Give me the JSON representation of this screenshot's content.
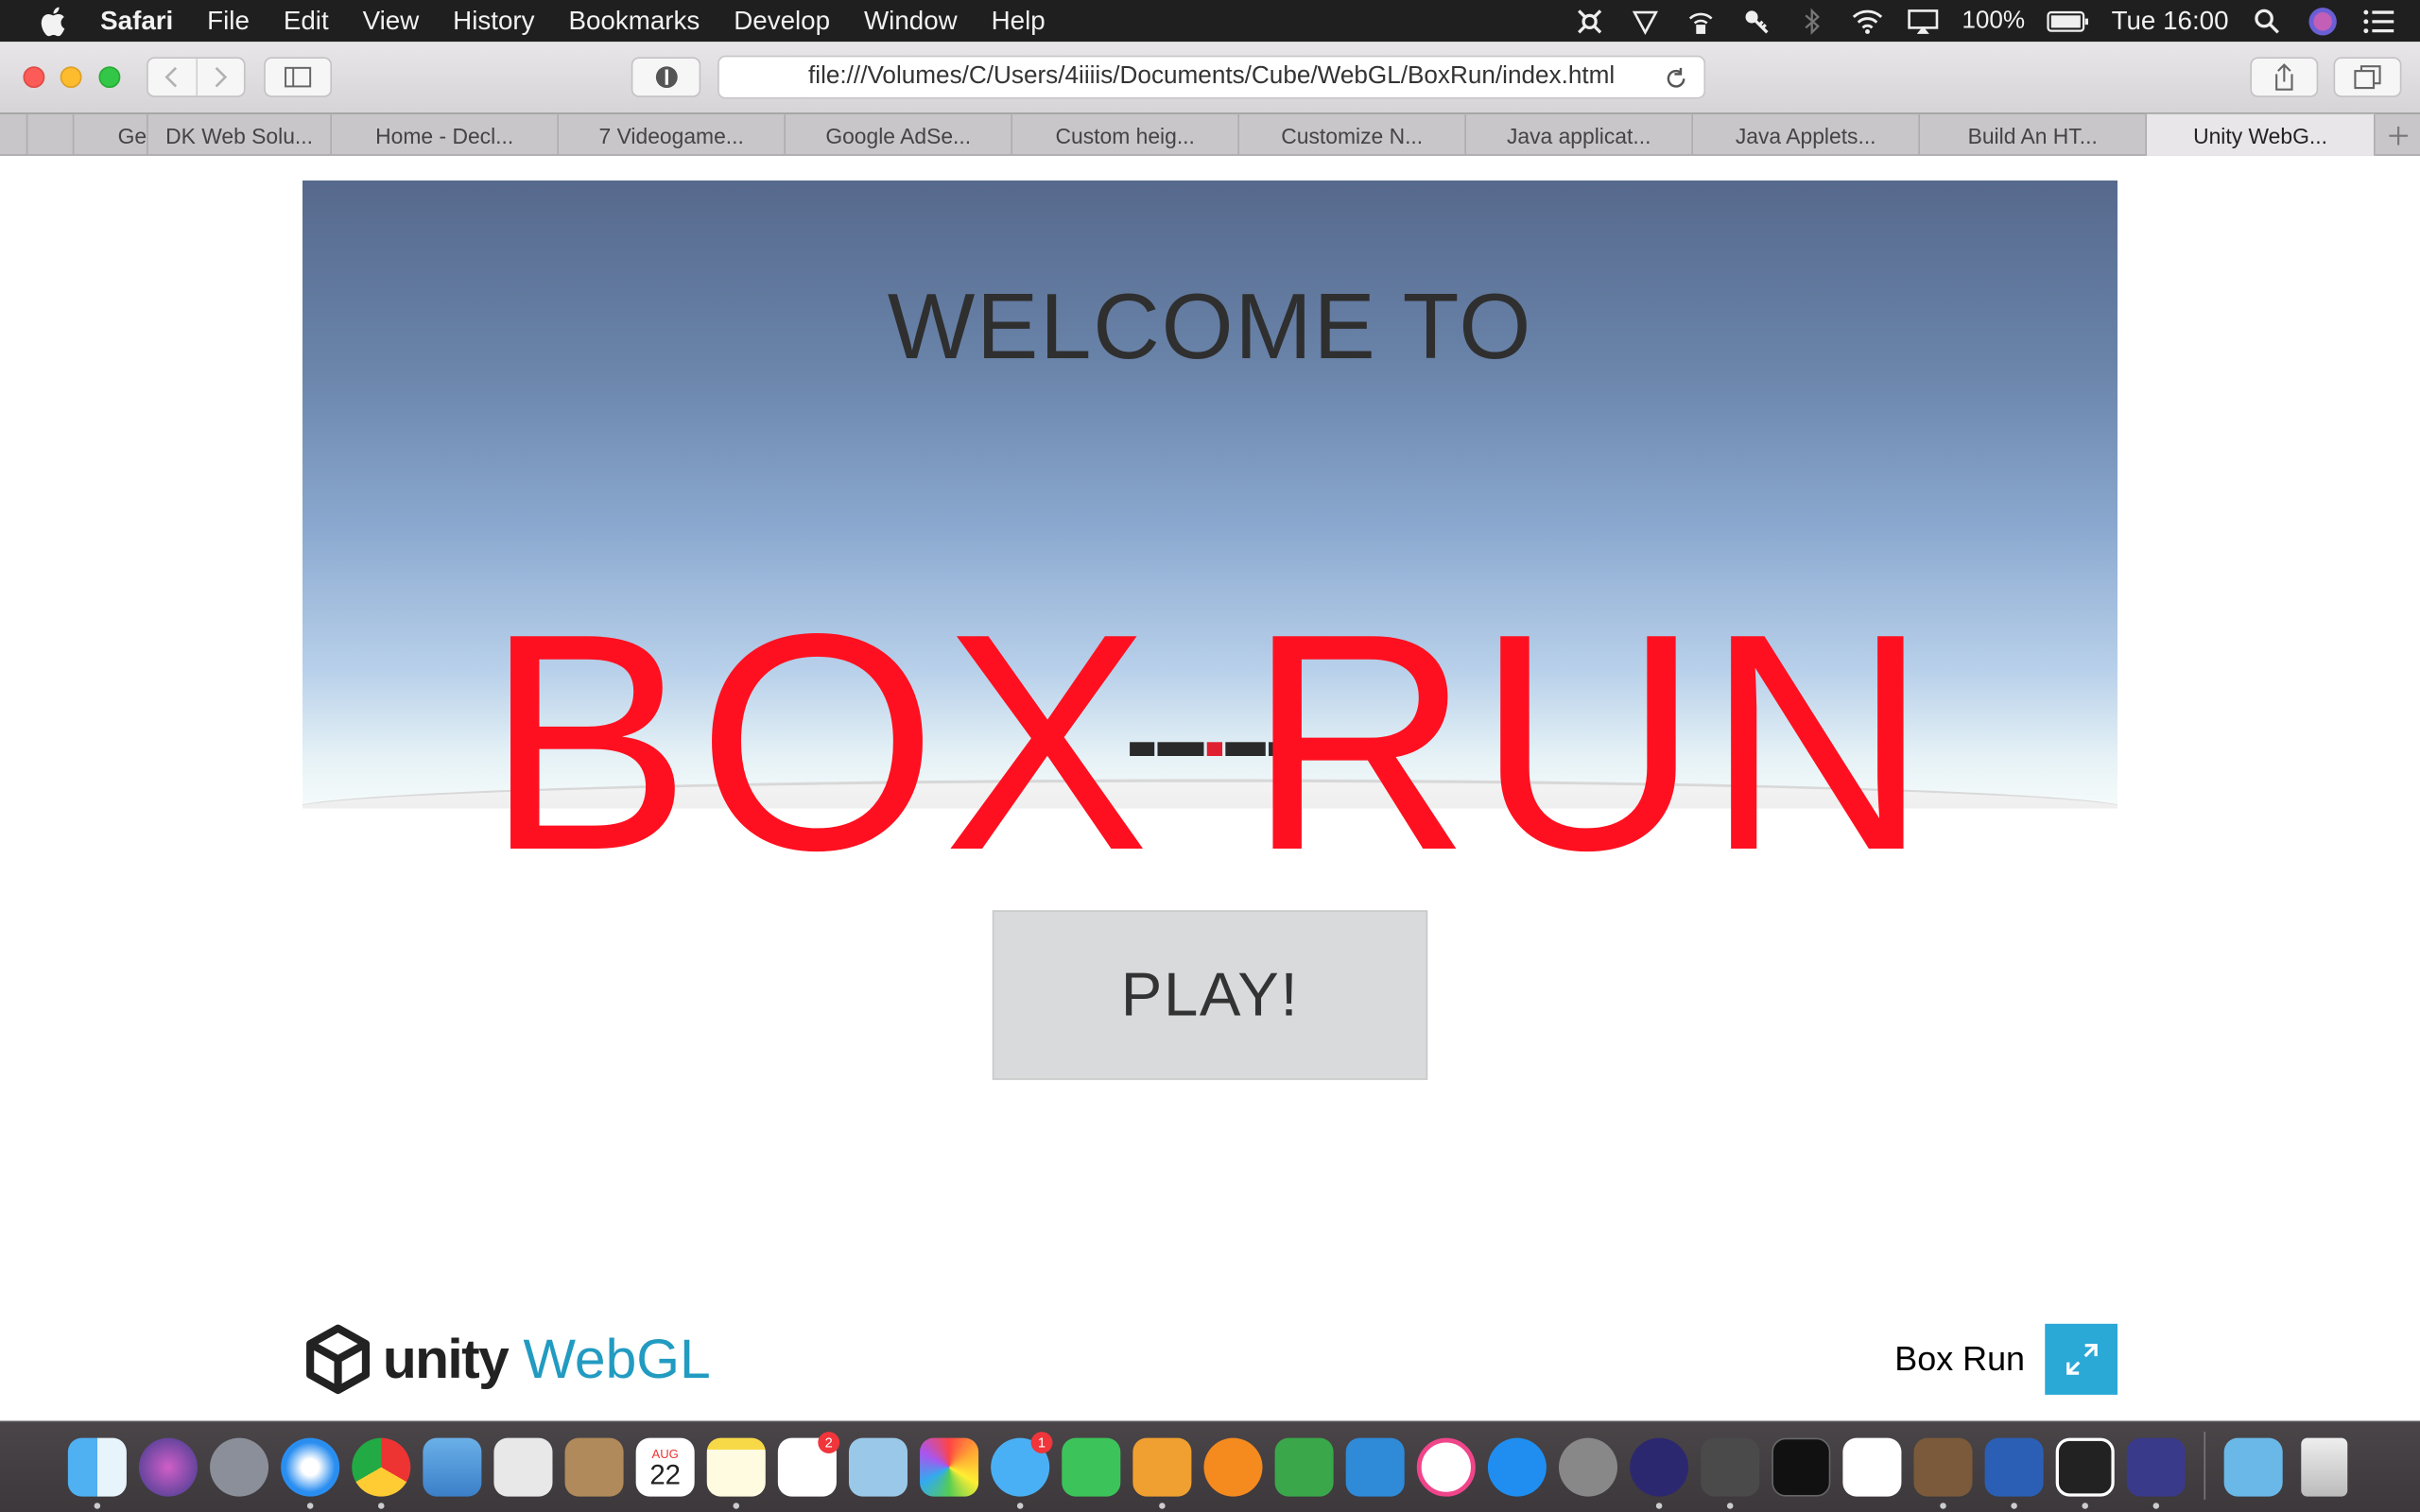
{
  "menubar": {
    "app_name": "Safari",
    "items": [
      "File",
      "Edit",
      "View",
      "History",
      "Bookmarks",
      "Develop",
      "Window",
      "Help"
    ],
    "battery": "100%",
    "clock": "Tue 16:00"
  },
  "toolbar": {
    "url": "file:///Volumes/C/Users/4iiiis/Documents/Cube/WebGL/BoxRun/index.html"
  },
  "tabs": [
    {
      "label": ""
    },
    {
      "label": "Ge"
    },
    {
      "label": "DK Web Solu..."
    },
    {
      "label": "Home - Decl..."
    },
    {
      "label": "7 Videogame..."
    },
    {
      "label": "Google AdSe..."
    },
    {
      "label": "Custom heig..."
    },
    {
      "label": "Customize N..."
    },
    {
      "label": "Java applicat..."
    },
    {
      "label": "Java Applets..."
    },
    {
      "label": "Build An HT..."
    },
    {
      "label": "Unity WebG..."
    }
  ],
  "game": {
    "welcome": "WELCOME TO",
    "title": "BOX RUN",
    "play_label": "PLAY!"
  },
  "footer": {
    "unity_word": "unity",
    "webgl_word": "WebGL",
    "game_title": "Box Run"
  },
  "dock": {
    "reminders_badge": "2",
    "messages_badge": "1",
    "calendar_month": "AUG",
    "calendar_day": "22"
  },
  "colors": {
    "title_red": "#ff1020",
    "webgl_blue": "#229bc1",
    "fullscreen_blue": "#2aa8d6"
  }
}
